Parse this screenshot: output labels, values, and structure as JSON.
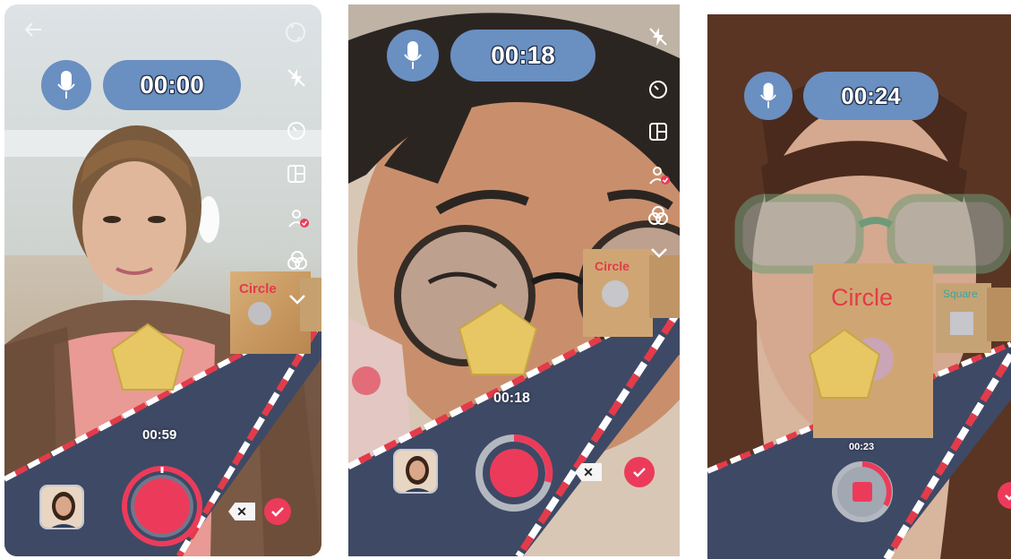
{
  "screens": [
    {
      "timer": "00:00",
      "countdown": "00:59",
      "block_label": "Circle",
      "recording_progress": 0.0
    },
    {
      "timer": "00:18",
      "countdown": "00:18",
      "block_label": "Circle",
      "recording_progress": 0.3
    },
    {
      "timer": "00:24",
      "countdown": "00:23",
      "block_label": "Circle",
      "block_label_2": "Square",
      "recording_progress": 0.4
    }
  ],
  "icons": {
    "mic": "microphone-icon",
    "flash": "flash-off-icon",
    "speed": "speed-timer-icon",
    "layout": "layout-grid-icon",
    "effects": "face-effect-icon",
    "filters": "filters-icon",
    "more": "chevron-down-icon",
    "back": "back-arrow-icon",
    "flip": "flip-camera-icon",
    "delete": "delete-clip-icon",
    "confirm": "checkmark-icon"
  },
  "delete_glyph": "✕",
  "colors": {
    "accent": "#ec3b5a",
    "pill": "#6a8fc1",
    "track": "#3e4965",
    "shape": "#e6c763"
  }
}
